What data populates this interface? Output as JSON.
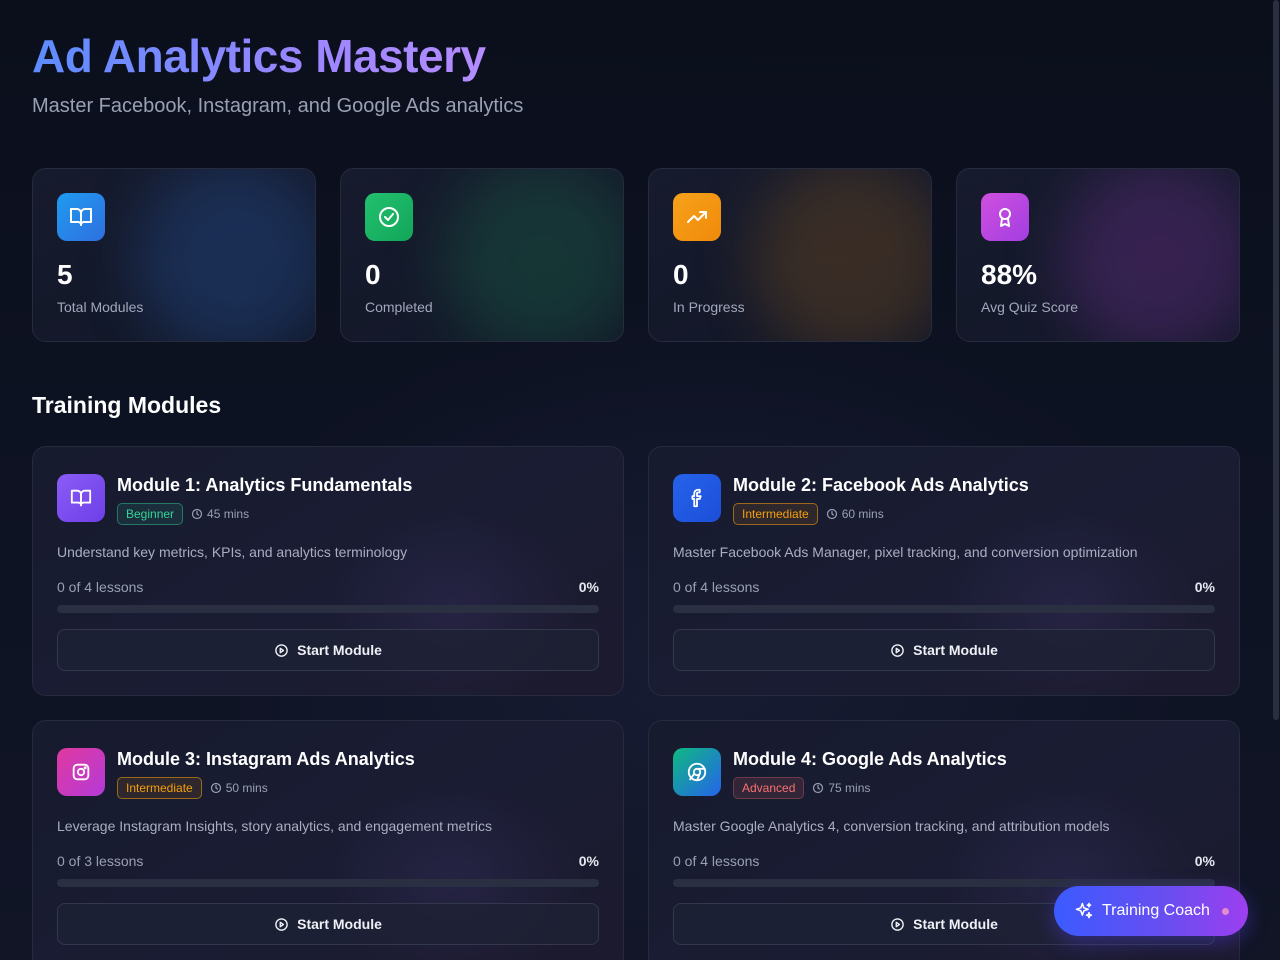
{
  "header": {
    "title": "Ad Analytics Mastery",
    "subtitle": "Master Facebook, Instagram, and Google Ads analytics"
  },
  "stats": [
    {
      "value": "5",
      "label": "Total Modules",
      "icon": "book-open-icon",
      "color": "#2f8df0"
    },
    {
      "value": "0",
      "label": "Completed",
      "icon": "check-circle-icon",
      "color": "#22c06e"
    },
    {
      "value": "0",
      "label": "In Progress",
      "icon": "trending-up-icon",
      "color": "#f59e0b"
    },
    {
      "value": "88%",
      "label": "Avg Quiz Score",
      "icon": "award-icon",
      "color": "#c04be0"
    }
  ],
  "section_title": "Training Modules",
  "modules": [
    {
      "title": "Module 1: Analytics Fundamentals",
      "level": "Beginner",
      "duration": "45 mins",
      "description": "Understand key metrics, KPIs, and analytics terminology",
      "lessons": "0 of 4 lessons",
      "percent": "0%",
      "progress": 0,
      "button": "Start Module",
      "icon": "book-open-icon"
    },
    {
      "title": "Module 2: Facebook Ads Analytics",
      "level": "Intermediate",
      "duration": "60 mins",
      "description": "Master Facebook Ads Manager, pixel tracking, and conversion optimization",
      "lessons": "0 of 4 lessons",
      "percent": "0%",
      "progress": 0,
      "button": "Start Module",
      "icon": "facebook-icon"
    },
    {
      "title": "Module 3: Instagram Ads Analytics",
      "level": "Intermediate",
      "duration": "50 mins",
      "description": "Leverage Instagram Insights, story analytics, and engagement metrics",
      "lessons": "0 of 3 lessons",
      "percent": "0%",
      "progress": 0,
      "button": "Start Module",
      "icon": "instagram-icon"
    },
    {
      "title": "Module 4: Google Ads Analytics",
      "level": "Advanced",
      "duration": "75 mins",
      "description": "Master Google Analytics 4, conversion tracking, and attribution models",
      "lessons": "0 of 4 lessons",
      "percent": "0%",
      "progress": 0,
      "button": "Start Module",
      "icon": "chrome-icon"
    }
  ],
  "coach": {
    "label": "Training Coach",
    "icon": "sparkles-icon"
  }
}
